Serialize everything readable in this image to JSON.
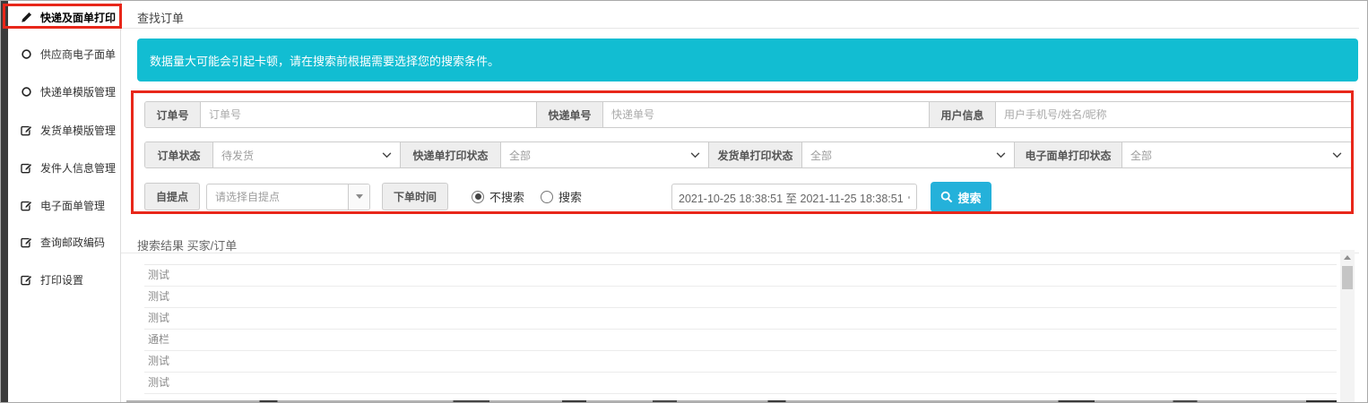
{
  "sidebar": {
    "items": [
      {
        "label": "快递及面单打印",
        "icon": "pencil-icon",
        "active": true
      },
      {
        "label": "供应商电子面单",
        "icon": "circle-icon",
        "active": false
      },
      {
        "label": "快递单模版管理",
        "icon": "circle-icon",
        "active": false
      },
      {
        "label": "发货单模版管理",
        "icon": "edit-icon",
        "active": false
      },
      {
        "label": "发件人信息管理",
        "icon": "edit-icon",
        "active": false
      },
      {
        "label": "电子面单管理",
        "icon": "edit-icon",
        "active": false
      },
      {
        "label": "查询邮政编码",
        "icon": "edit-icon",
        "active": false
      },
      {
        "label": "打印设置",
        "icon": "edit-icon",
        "active": false
      }
    ]
  },
  "header": {
    "title": "查找订单"
  },
  "notice": {
    "text": "数据量大可能会引起卡顿，请在搜索前根据需要选择您的搜索条件。"
  },
  "form": {
    "row1": [
      {
        "label": "订单号",
        "placeholder": "订单号",
        "value": ""
      },
      {
        "label": "快递单号",
        "placeholder": "快递单号",
        "value": ""
      },
      {
        "label": "用户信息",
        "placeholder": "用户手机号/姓名/昵称",
        "value": ""
      }
    ],
    "row2": [
      {
        "label": "订单状态",
        "value": "待发货"
      },
      {
        "label": "快递单打印状态",
        "value": "全部"
      },
      {
        "label": "发货单打印状态",
        "value": "全部"
      },
      {
        "label": "电子面单打印状态",
        "value": "全部"
      }
    ],
    "row3": {
      "pickup_label": "自提点",
      "pickup_placeholder": "请选择自提点",
      "time_label": "下单时间",
      "radio_no_search": "不搜索",
      "radio_search": "搜索",
      "time_mode_selected": "不搜索",
      "date_range": "2021-10-25 18:38:51 至 2021-11-25 18:38:51",
      "search_button": "搜索"
    }
  },
  "results": {
    "header": "搜索结果 买家/订单",
    "rows": [
      "测试",
      "测试",
      "测试",
      "通栏",
      "测试",
      "测试"
    ]
  },
  "colors": {
    "notice_cyan": "#12bdd2",
    "button_cyan": "#24b1da",
    "annotation_red": "#e8271a",
    "left_strip_dark": "#3b3b3b",
    "label_bg": "#eeeeee"
  }
}
